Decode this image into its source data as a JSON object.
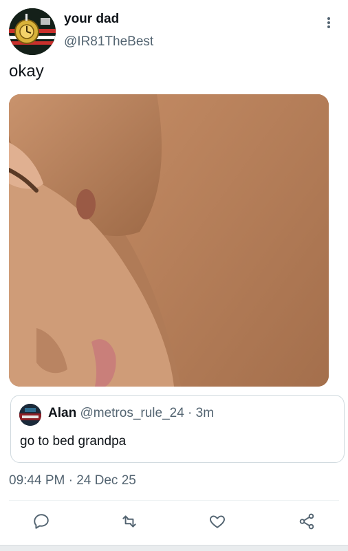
{
  "tweet": {
    "display_name": "your dad",
    "handle": "@IR81TheBest",
    "text": "okay",
    "avatar_icon": "clock-emblem-avatar",
    "media_description_icon": "photo-media"
  },
  "quote": {
    "name": "Alan",
    "handle": "@metros_rule_24",
    "separator": " · ",
    "age": "3m",
    "text": "go to bed grandpa"
  },
  "timestamp": "09:44 PM · 24 Dec 25",
  "actions": {
    "reply_icon": "reply-icon",
    "retweet_icon": "retweet-icon",
    "like_icon": "heart-icon",
    "share_icon": "share-icon"
  },
  "colors": {
    "text_primary": "#0f1419",
    "text_secondary": "#536471",
    "border": "#cfd9de",
    "icon": "#536471"
  }
}
